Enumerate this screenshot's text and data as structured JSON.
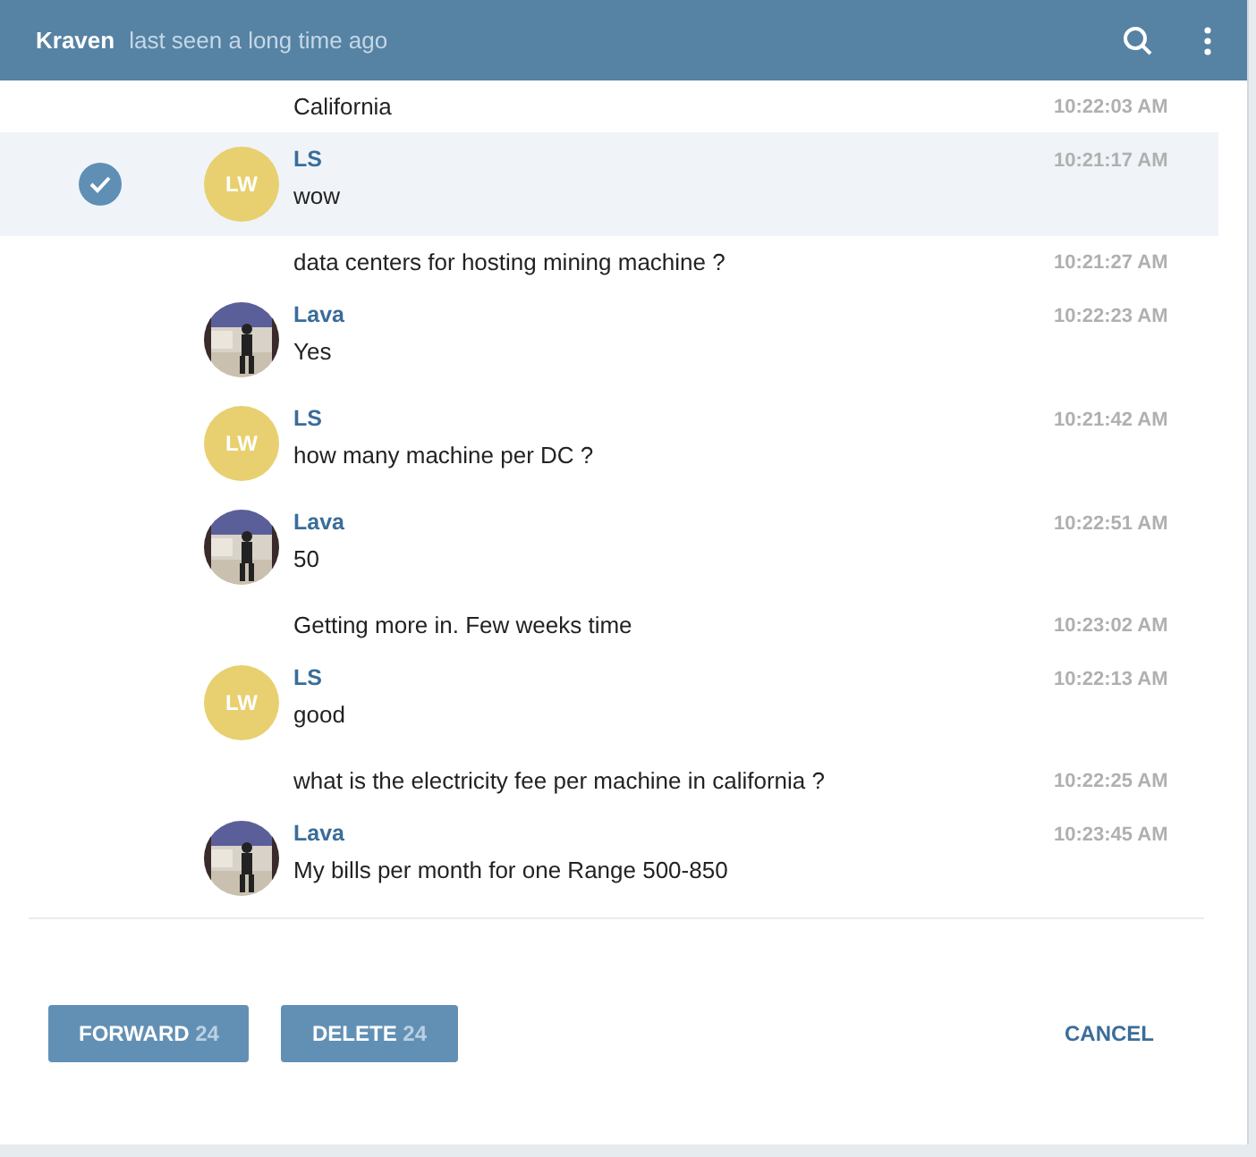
{
  "header": {
    "title": "Kraven",
    "status": "last seen a long time ago"
  },
  "messages": [
    {
      "kind": "continuation",
      "text": "California",
      "time": "10:22:03 AM",
      "selected": false
    },
    {
      "kind": "initials",
      "initials": "LW",
      "name": "LS",
      "text": "wow",
      "time": "10:21:17 AM",
      "selected": true
    },
    {
      "kind": "continuation",
      "text": "data centers for hosting mining machine ?",
      "time": "10:21:27 AM",
      "selected": false
    },
    {
      "kind": "picture",
      "name": "Lava",
      "text": "Yes",
      "time": "10:22:23 AM",
      "selected": false
    },
    {
      "kind": "initials",
      "initials": "LW",
      "name": "LS",
      "text": "how many machine per DC ?",
      "time": "10:21:42 AM",
      "selected": false
    },
    {
      "kind": "picture",
      "name": "Lava",
      "text": "50",
      "time": "10:22:51 AM",
      "selected": false
    },
    {
      "kind": "continuation",
      "text": "Getting more in. Few weeks time",
      "time": "10:23:02 AM",
      "selected": false
    },
    {
      "kind": "initials",
      "initials": "LW",
      "name": "LS",
      "text": "good",
      "time": "10:22:13 AM",
      "selected": false
    },
    {
      "kind": "continuation",
      "text": "what is the electricity fee per machine in california ?",
      "time": "10:22:25 AM",
      "selected": false
    },
    {
      "kind": "picture",
      "name": "Lava",
      "text": "My bills per month for one Range 500-850",
      "time": "10:23:45 AM",
      "selected": false
    }
  ],
  "actions": [
    {
      "label": "FORWARD",
      "count": "24"
    },
    {
      "label": "DELETE",
      "count": "24"
    }
  ],
  "cancel": "CANCEL"
}
